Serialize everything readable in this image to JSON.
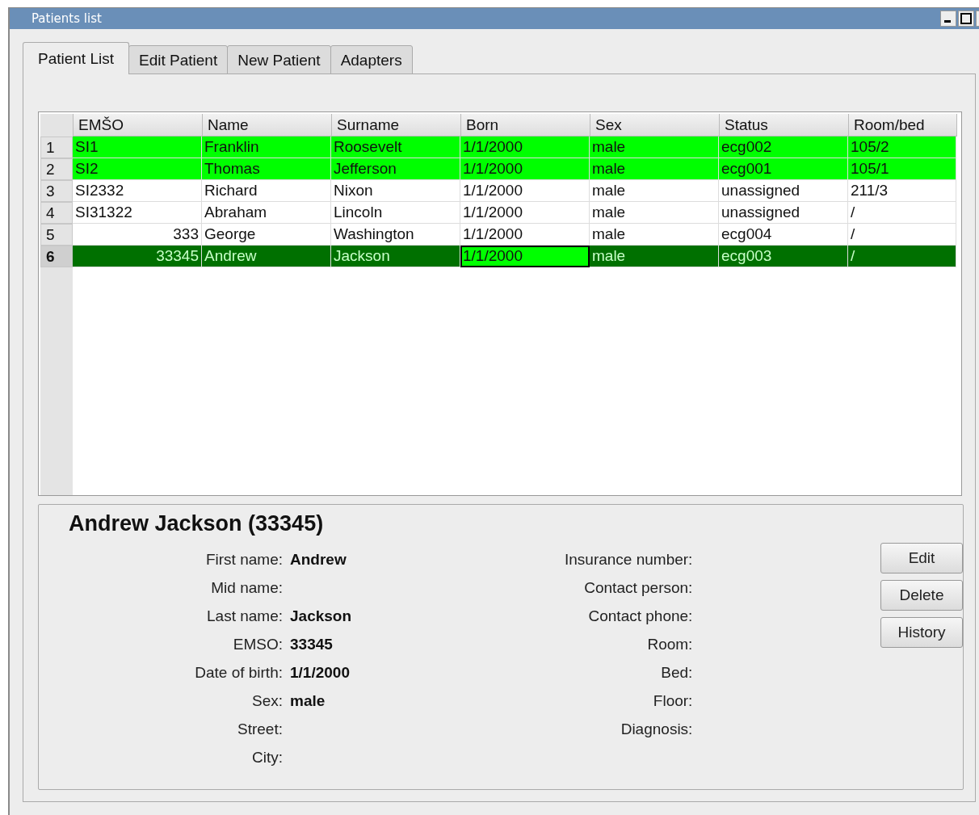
{
  "window": {
    "title": "Patients list"
  },
  "tabs": [
    {
      "label": "Patient List",
      "selected": true
    },
    {
      "label": "Edit Patient",
      "selected": false
    },
    {
      "label": "New Patient",
      "selected": false
    },
    {
      "label": "Adapters",
      "selected": false
    }
  ],
  "table": {
    "columns": [
      "EMŠO",
      "Name",
      "Surname",
      "Born",
      "Sex",
      "Status",
      "Room/bed"
    ],
    "rows": [
      {
        "number": "1",
        "selected": false,
        "color": "#00ff00",
        "cells": [
          {
            "text": "SI1",
            "focused": false
          },
          {
            "text": "Franklin",
            "focused": false
          },
          {
            "text": "Roosevelt",
            "focused": false
          },
          {
            "text": "1/1/2000",
            "focused": false
          },
          {
            "text": "male",
            "focused": false
          },
          {
            "text": "ecg002",
            "focused": false
          },
          {
            "text": "105/2",
            "focused": false
          }
        ]
      },
      {
        "number": "2",
        "selected": false,
        "color": "#00ff00",
        "cells": [
          {
            "text": "SI2",
            "focused": false
          },
          {
            "text": "Thomas",
            "focused": false
          },
          {
            "text": "Jefferson",
            "focused": false
          },
          {
            "text": "1/1/2000",
            "focused": false
          },
          {
            "text": "male",
            "focused": false
          },
          {
            "text": "ecg001",
            "focused": false
          },
          {
            "text": "105/1",
            "focused": false
          }
        ]
      },
      {
        "number": "3",
        "selected": false,
        "color": "#ffffff",
        "cells": [
          {
            "text": "SI2332",
            "focused": false
          },
          {
            "text": "Richard",
            "focused": false
          },
          {
            "text": "Nixon",
            "focused": false
          },
          {
            "text": "1/1/2000",
            "focused": false
          },
          {
            "text": "male",
            "focused": false
          },
          {
            "text": "unassigned",
            "focused": false
          },
          {
            "text": "211/3",
            "focused": false
          }
        ]
      },
      {
        "number": "4",
        "selected": false,
        "color": "#ffffff",
        "cells": [
          {
            "text": "SI31322",
            "focused": false
          },
          {
            "text": "Abraham",
            "focused": false
          },
          {
            "text": "Lincoln",
            "focused": false
          },
          {
            "text": "1/1/2000",
            "focused": false
          },
          {
            "text": "male",
            "focused": false
          },
          {
            "text": "unassigned",
            "focused": false
          },
          {
            "text": "/",
            "focused": false
          }
        ]
      },
      {
        "number": "5",
        "selected": false,
        "color": "#ffffff",
        "cells": [
          {
            "text": "333",
            "focused": false
          },
          {
            "text": "George",
            "focused": false
          },
          {
            "text": "Washington",
            "focused": false
          },
          {
            "text": "1/1/2000",
            "focused": false
          },
          {
            "text": "male",
            "focused": false
          },
          {
            "text": "ecg004",
            "focused": false
          },
          {
            "text": "/",
            "focused": false
          }
        ]
      },
      {
        "number": "6",
        "selected": true,
        "color": "#00ff00",
        "cells": [
          {
            "text": "33345",
            "focused": false
          },
          {
            "text": "Andrew",
            "focused": false
          },
          {
            "text": "Jackson",
            "focused": false
          },
          {
            "text": "1/1/2000",
            "focused": true
          },
          {
            "text": "male",
            "focused": false
          },
          {
            "text": "ecg003",
            "focused": false
          },
          {
            "text": "/",
            "focused": false
          }
        ]
      }
    ]
  },
  "details": {
    "title": "Andrew Jackson (33345)",
    "left_fields": [
      {
        "label": "First name:",
        "value": "Andrew"
      },
      {
        "label": "Mid name:"
      },
      {
        "label": "Last name:",
        "value": "Jackson"
      },
      {
        "label": "EMSO:",
        "value": "33345"
      },
      {
        "label": "Date of birth:",
        "value": "1/1/2000"
      },
      {
        "label": "Sex:",
        "value": "male"
      },
      {
        "label": "Street:"
      },
      {
        "label": "City:"
      }
    ],
    "right_fields": [
      {
        "label": "Insurance number:"
      },
      {
        "label": "Contact person:"
      },
      {
        "label": "Contact phone:"
      },
      {
        "label": "Room:"
      },
      {
        "label": "Bed:"
      },
      {
        "label": "Floor:"
      },
      {
        "label": "Diagnosis:"
      }
    ],
    "buttons": [
      "Edit",
      "Delete",
      "History"
    ]
  }
}
